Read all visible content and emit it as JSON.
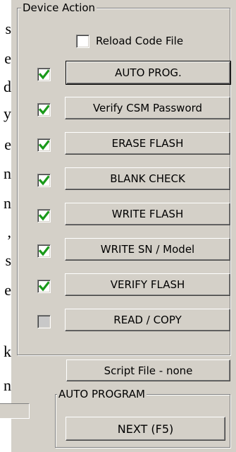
{
  "document_strip": {
    "chars": [
      "s",
      "e",
      "d",
      "y",
      "e",
      "n",
      "n",
      ",",
      "s",
      "e",
      "",
      "k",
      "n"
    ]
  },
  "device_action": {
    "title": "Device Action",
    "reload_label": "Reload Code File",
    "reload_checked": false,
    "actions": [
      {
        "label": "AUTO PROG.",
        "checked": true,
        "enabled": true
      },
      {
        "label": "Verify CSM Password",
        "checked": true,
        "enabled": true
      },
      {
        "label": "ERASE FLASH",
        "checked": true,
        "enabled": true
      },
      {
        "label": "BLANK CHECK",
        "checked": true,
        "enabled": true
      },
      {
        "label": "WRITE FLASH",
        "checked": true,
        "enabled": true
      },
      {
        "label": "WRITE SN / Model",
        "checked": true,
        "enabled": true
      },
      {
        "label": "VERIFY FLASH",
        "checked": true,
        "enabled": true
      },
      {
        "label": "READ / COPY",
        "checked": false,
        "enabled": false
      }
    ]
  },
  "script_file_label": "Script File - none",
  "auto_program": {
    "title": "AUTO PROGRAM",
    "next_label": "NEXT  (F5)"
  },
  "colors": {
    "face": "#d4d0c8",
    "check_green": "#1a9a1a"
  },
  "icons": {
    "check": "green-check-icon"
  }
}
